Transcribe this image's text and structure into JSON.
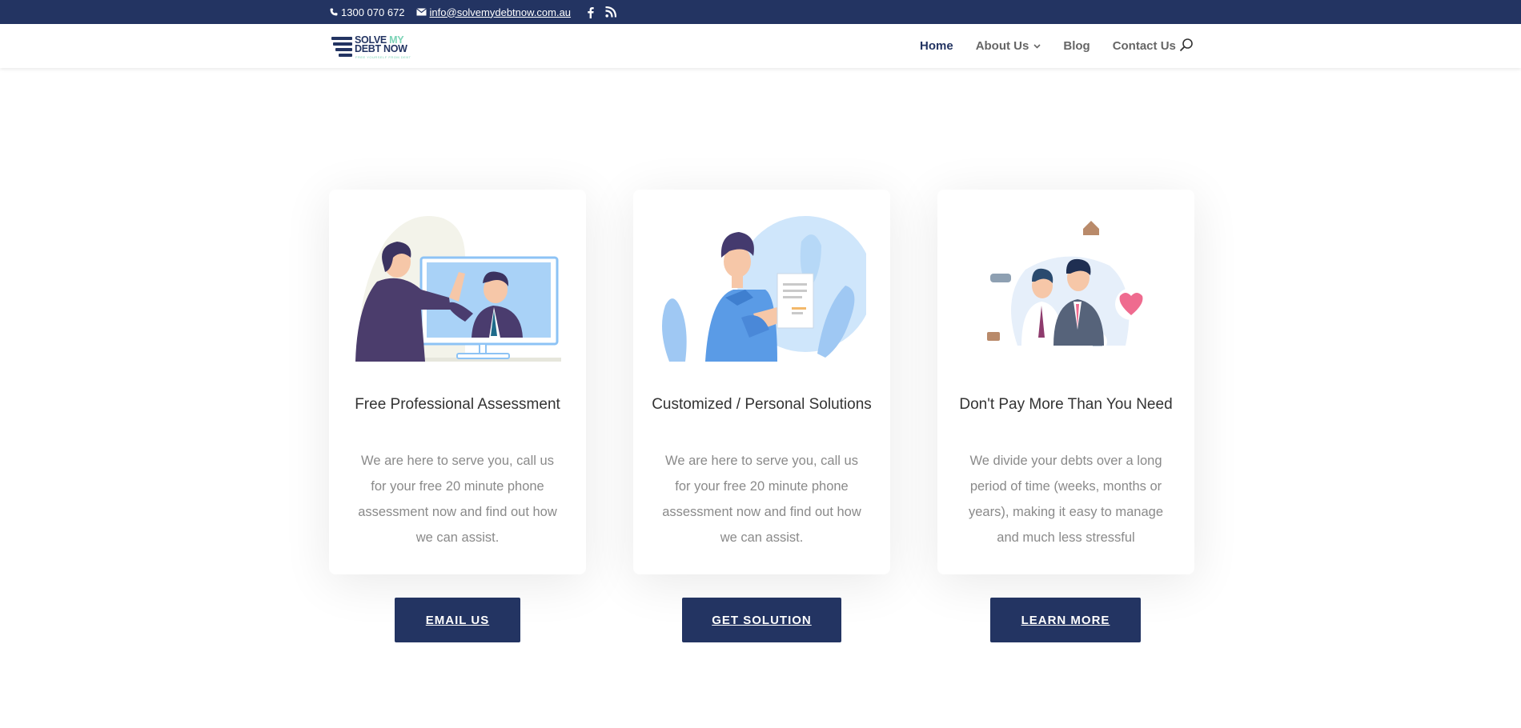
{
  "topbar": {
    "phone": "1300 070 672",
    "email": "info@solvemydebtnow.com.au",
    "social": [
      "facebook-icon",
      "rss-icon"
    ],
    "background": "#233462"
  },
  "logo": {
    "line1_a": "SOLVE",
    "line1_b": "MY",
    "line2": "DEBT NOW",
    "tagline": "FREE YOURSELF FROM DEBT"
  },
  "nav": {
    "items": [
      {
        "label": "Home",
        "active": true
      },
      {
        "label": "About Us",
        "has_dropdown": true
      },
      {
        "label": "Blog"
      },
      {
        "label": "Contact Us"
      }
    ],
    "search_icon": "search-icon"
  },
  "cards": [
    {
      "illustration": "video-call-illustration",
      "title": "Free Professional Assessment",
      "text": "We are here to serve you, call us for your free 20 minute phone assessment now and find out how we can assist.",
      "button": "EMAIL US"
    },
    {
      "illustration": "document-review-illustration",
      "title": "Customized / Personal Solutions",
      "text": "We are here to serve you, call us for your free 20 minute phone assessment now and find out how we can assist.",
      "button": "GET SOLUTION"
    },
    {
      "illustration": "financial-advisors-illustration",
      "title": "Don't Pay More Than You Need",
      "text": "We divide your debts over a long period of time (weeks, months or years), making it easy to manage and much less stressful",
      "button": "LEARN MORE"
    }
  ],
  "colors": {
    "brand": "#233462",
    "accent": "#7bd3b6",
    "body_text": "#8a8a8a"
  }
}
